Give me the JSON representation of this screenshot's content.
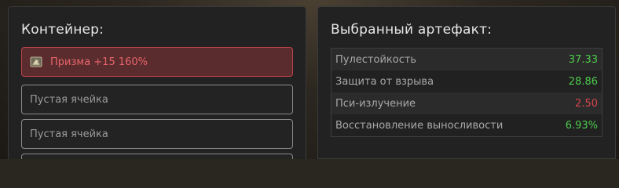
{
  "container": {
    "title": "Контейнер:",
    "slots": [
      {
        "label": "Призма +15 160%",
        "selected": true,
        "icon": "artifact-icon"
      },
      {
        "label": "Пустая ячейка",
        "selected": false
      },
      {
        "label": "Пустая ячейка",
        "selected": false
      },
      {
        "label": "",
        "selected": false
      }
    ]
  },
  "selected_artifact": {
    "title": "Выбранный артефакт:",
    "stats": [
      {
        "name": "Пулестойкость",
        "value": "37.33",
        "status": "good"
      },
      {
        "name": "Защита от взрыва",
        "value": "28.86",
        "status": "good"
      },
      {
        "name": "Пси-излучение",
        "value": "2.50",
        "status": "bad"
      },
      {
        "name": "Восстановление выносливости",
        "value": "6.93%",
        "status": "good"
      }
    ]
  },
  "colors": {
    "positive": "#4ecb4e",
    "negative": "#d9454a",
    "selected_slot_border": "#c0424a",
    "selected_slot_bg": "#5a2c2e"
  }
}
